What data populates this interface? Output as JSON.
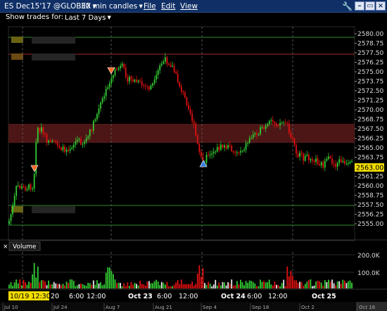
{
  "window": {
    "instrument": "ES Dec15'17 @GLOBEX",
    "timeframe": "30 min candles",
    "menus": [
      "File",
      "Edit",
      "View"
    ]
  },
  "subbar": {
    "label": "Show trades for:",
    "range_value": "Last 7 Days"
  },
  "price_chart": {
    "y_ticks": [
      "2580.00",
      "2578.75",
      "2577.50",
      "2576.25",
      "2575.00",
      "2573.75",
      "2572.50",
      "2571.25",
      "2570.00",
      "2568.75",
      "2567.50",
      "2566.25",
      "2565.00",
      "2563.75",
      "2562.50",
      "2561.25",
      "2560.00",
      "2558.75",
      "2557.50",
      "2556.25",
      "2555.00"
    ],
    "last_price_label": "2563.00",
    "ymin": 2554.4,
    "ymax": 2580.6
  },
  "volume_panel": {
    "title": "Volume",
    "y_ticks": [
      "200.0K",
      "100.0K"
    ]
  },
  "x_axis": {
    "labels": [
      "20",
      "6:00",
      "12:00",
      "Oct 23",
      "6:00",
      "12:00",
      "Oct 24",
      "6:00",
      "12:00",
      "Oct 25"
    ],
    "cursor_time": "10/19 12:30"
  },
  "overview_strip": {
    "labels": [
      "Jul 10",
      "Jul 24",
      "Aug 7",
      "Aug 21",
      "Sep 4",
      "Sep 18",
      "Oct 2",
      "Oct 16"
    ]
  },
  "colors": {
    "titlebar_bg": "#0f2f66",
    "up_candle": "#33cc33",
    "down_candle": "#e01010",
    "neutral_volume": "#e8e8e8",
    "last_price_bg": "#f2dc00",
    "horizontal_line": "#2e8b2e",
    "resistance_line": "#a02a2a",
    "zone_band": "#5a1a1a",
    "marker_sell": "#ff6a2a",
    "marker_buy": "#3a7fe0"
  }
}
